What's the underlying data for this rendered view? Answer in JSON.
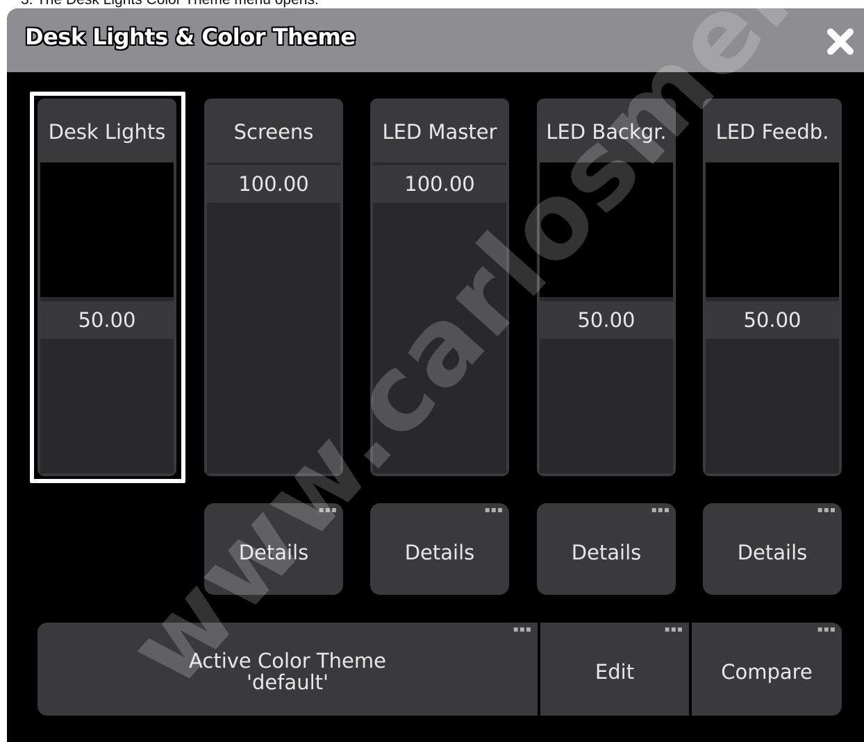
{
  "doc_caption": "3.   The Desk Lights Color Theme menu opens.",
  "window": {
    "title": "Desk Lights & Color Theme"
  },
  "faders": [
    {
      "label": "Desk Lights",
      "value": "50.00",
      "level": 0.5,
      "selected": true
    },
    {
      "label": "Screens",
      "value": "100.00",
      "level": 1.0,
      "selected": false
    },
    {
      "label": "LED Master",
      "value": "100.00",
      "level": 1.0,
      "selected": false
    },
    {
      "label": "LED Backgr.",
      "value": "50.00",
      "level": 0.5,
      "selected": false
    },
    {
      "label": "LED Feedb.",
      "value": "50.00",
      "level": 0.5,
      "selected": false
    }
  ],
  "details_buttons": [
    "Details",
    "Details",
    "Details",
    "Details"
  ],
  "theme": {
    "line1": "Active Color Theme",
    "line2": "'default'",
    "edit_label": "Edit",
    "compare_label": "Compare"
  },
  "watermark": "www.carlosmendoza.co",
  "icons": {
    "close": "close-x-icon",
    "more": "more-dots-icon"
  },
  "colors": {
    "titlebar": "#8e8e92",
    "background": "#000000",
    "control": "#3a3a3c",
    "selection": "#ffffff"
  }
}
